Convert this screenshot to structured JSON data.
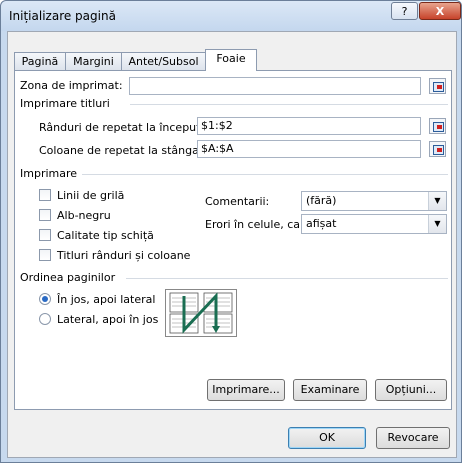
{
  "window": {
    "title": "Inițializare pagină",
    "help_glyph": "?",
    "close_glyph": "X"
  },
  "tabs": [
    {
      "label": "Pagină"
    },
    {
      "label": "Margini"
    },
    {
      "label": "Antet/Subsol"
    },
    {
      "label": "Foaie"
    }
  ],
  "print_area": {
    "label": "Zona de imprimat:",
    "value": ""
  },
  "print_titles": {
    "section": "Imprimare titluri",
    "rows_label": "Rânduri de repetat la început:",
    "rows_value": "$1:$2",
    "cols_label": "Coloane de repetat la stânga:",
    "cols_value": "$A:$A"
  },
  "print": {
    "section": "Imprimare",
    "gridlines": "Linii de grilă",
    "black_white": "Alb-negru",
    "draft": "Calitate tip schiță",
    "headings": "Titluri rânduri și coloane",
    "comments_label": "Comentarii:",
    "comments_value": "(fără)",
    "errors_label": "Erori în celule, ca:",
    "errors_value": "afișat"
  },
  "page_order": {
    "section": "Ordinea paginilor",
    "down_then_over": "În jos, apoi lateral",
    "over_then_down": "Lateral, apoi în jos"
  },
  "buttons": {
    "print": "Imprimare...",
    "preview": "Examinare",
    "options": "Opțiuni...",
    "ok": "OK",
    "cancel": "Revocare"
  }
}
